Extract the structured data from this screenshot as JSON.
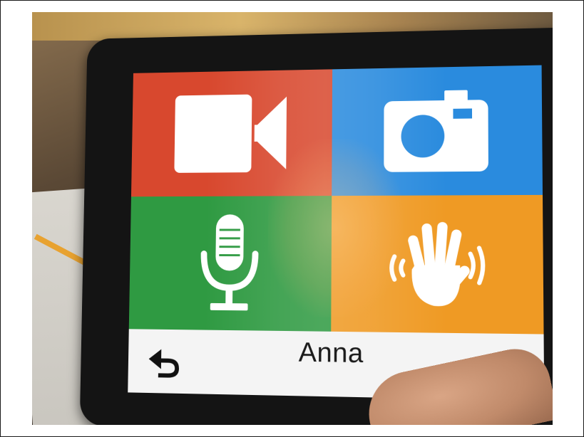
{
  "screen": {
    "tiles": [
      {
        "id": "video",
        "icon": "video-camera-icon",
        "color": "#d8482e"
      },
      {
        "id": "photo",
        "icon": "photo-camera-icon",
        "color": "#2a8bde"
      },
      {
        "id": "audio",
        "icon": "microphone-icon",
        "color": "#2f9a42"
      },
      {
        "id": "wave",
        "icon": "waving-hand-icon",
        "color": "#ef9a24"
      }
    ],
    "bottom_bar": {
      "back_icon": "back-arrow-icon",
      "contact_name": "Anna"
    }
  }
}
